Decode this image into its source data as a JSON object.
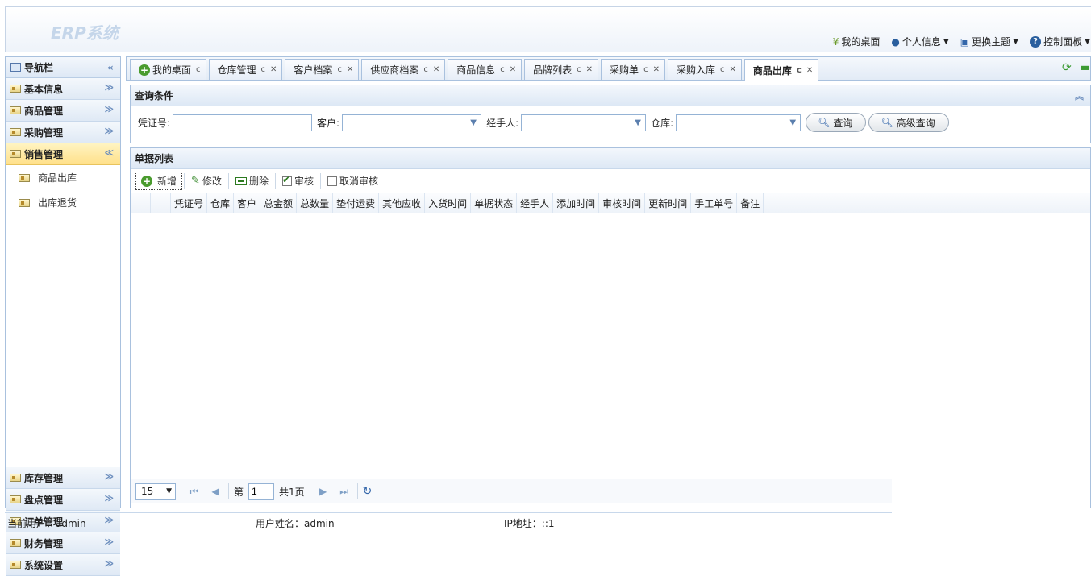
{
  "app": {
    "title": "ERP系统"
  },
  "topnav": {
    "items": [
      {
        "label": "我的桌面",
        "icon": "desktop-icon",
        "dropdown": false
      },
      {
        "label": "个人信息",
        "icon": "user-icon",
        "dropdown": true
      },
      {
        "label": "更换主题",
        "icon": "theme-icon",
        "dropdown": true
      },
      {
        "label": "控制面板",
        "icon": "help-icon",
        "dropdown": true
      }
    ]
  },
  "sidebar": {
    "title": "导航栏",
    "groups": [
      {
        "label": "基本信息"
      },
      {
        "label": "商品管理"
      },
      {
        "label": "采购管理"
      },
      {
        "label": "销售管理",
        "active": true,
        "items": [
          {
            "label": "商品出库"
          },
          {
            "label": "出库退货"
          }
        ]
      },
      {
        "label": "库存管理"
      },
      {
        "label": "盘点管理"
      },
      {
        "label": "订单管理"
      },
      {
        "label": "财务管理"
      },
      {
        "label": "系统设置"
      }
    ]
  },
  "tabs": [
    {
      "label": "我的桌面"
    },
    {
      "label": "仓库管理"
    },
    {
      "label": "客户档案"
    },
    {
      "label": "供应商档案"
    },
    {
      "label": "商品信息"
    },
    {
      "label": "品牌列表"
    },
    {
      "label": "采购单"
    },
    {
      "label": "采购入库"
    },
    {
      "label": "商品出库",
      "active": true
    }
  ],
  "query": {
    "title": "查询条件",
    "voucher_label": "凭证号:",
    "customer_label": "客户:",
    "handler_label": "经手人:",
    "warehouse_label": "仓库:",
    "search_button": "查询",
    "advanced_button": "高级查询"
  },
  "list": {
    "title": "单据列表",
    "toolbar": {
      "add": "新增",
      "edit": "修改",
      "delete": "删除",
      "approve": "审核",
      "unapprove": "取消审核"
    },
    "columns": [
      "凭证号",
      "仓库",
      "客户",
      "总金额",
      "总数量",
      "垫付运费",
      "其他应收",
      "入货时间",
      "单据状态",
      "经手人",
      "添加时间",
      "审核时间",
      "更新时间",
      "手工单号",
      "备注"
    ]
  },
  "pager": {
    "page_size": "15",
    "page_prefix": "第",
    "page_value": "1",
    "total": "共1页"
  },
  "footer": {
    "current_user": "当前用户：admin",
    "user_name": "用户姓名：admin",
    "ip": "IP地址：::1"
  },
  "colors": {
    "accent": "#a9c1de",
    "active_group": "#ffe08a"
  }
}
